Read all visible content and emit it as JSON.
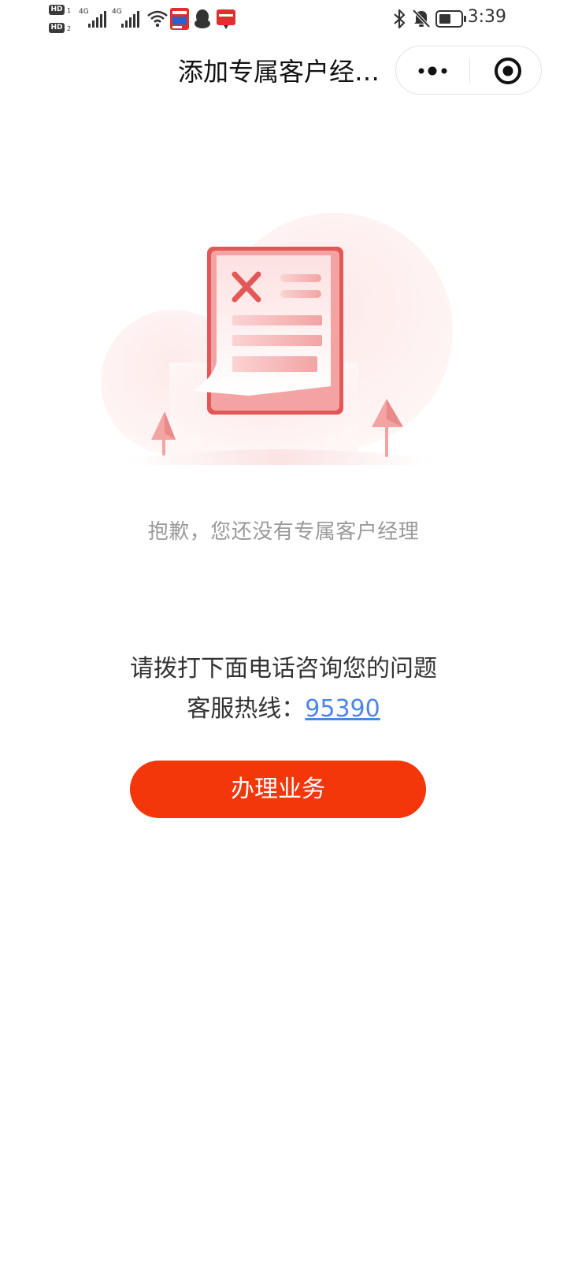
{
  "status_bar": {
    "sim1_badge": "HD",
    "sim1_index": "1",
    "sim2_badge": "HD",
    "sim2_index": "2",
    "network1": "4G",
    "network2": "4G",
    "time": "3:39"
  },
  "nav": {
    "title": "添加专属客户经…"
  },
  "empty_state": {
    "message": "抱歉，您还没有专属客户经理"
  },
  "contact": {
    "hint": "请拨打下面电话咨询您的问题",
    "hotline_label": "客服热线：",
    "hotline_number": "95390"
  },
  "actions": {
    "primary_label": "办理业务"
  },
  "colors": {
    "primary": "#f4360b",
    "link": "#4a86e8",
    "muted_text": "#9a9a9a",
    "illustration_red": "#e85a5a"
  }
}
